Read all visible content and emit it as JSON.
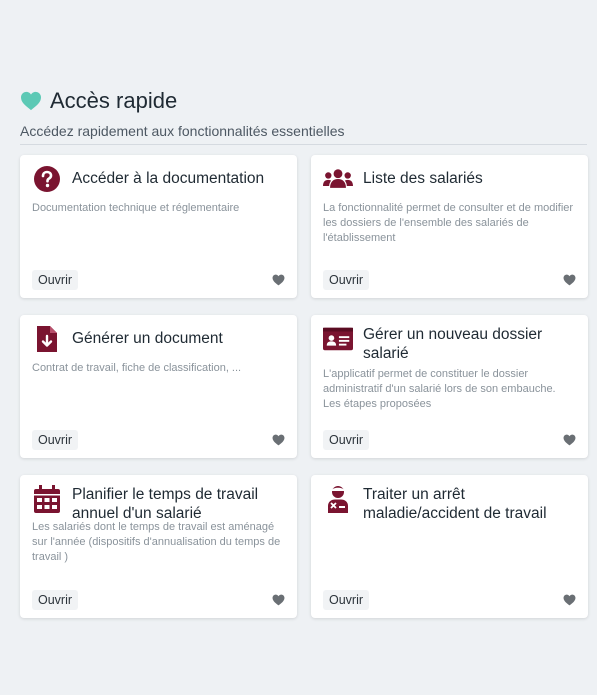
{
  "section": {
    "title": "Accès rapide",
    "subtitle": "Accédez rapidement aux fonctionnalités essentielles"
  },
  "cards": [
    {
      "title": "Accéder à la documentation",
      "description": "Documentation technique et réglementaire",
      "button": "Ouvrir",
      "icon": "question-circle-icon"
    },
    {
      "title": "Liste des salariés",
      "description": "La fonctionnalité permet de consulter et de modifier les dossiers de l'ensemble des salariés de l'établissement",
      "button": "Ouvrir",
      "icon": "users-icon"
    },
    {
      "title": "Générer un document",
      "description": "Contrat de travail, fiche de classification, ...",
      "button": "Ouvrir",
      "icon": "file-download-icon"
    },
    {
      "title": "Gérer un nouveau dossier salarié",
      "description": "L'applicatif permet de constituer le dossier administratif d'un salarié lors de son embauche. Les étapes proposées",
      "button": "Ouvrir",
      "icon": "id-card-icon"
    },
    {
      "title": "Planifier le temps de travail annuel d'un salarié",
      "description": "Les salariés dont le temps de travail est aménagé sur l'année (dispositifs d'annualisation du temps de travail )",
      "button": "Ouvrir",
      "icon": "calendar-icon"
    },
    {
      "title": "Traiter un arrêt maladie/accident de travail",
      "description": "",
      "button": "Ouvrir",
      "icon": "user-injured-icon"
    }
  ],
  "colors": {
    "accent": "#7a1430",
    "heart_accent": "#5cc9b5",
    "favorite": "#6a6f74",
    "background": "#eef1f4"
  }
}
